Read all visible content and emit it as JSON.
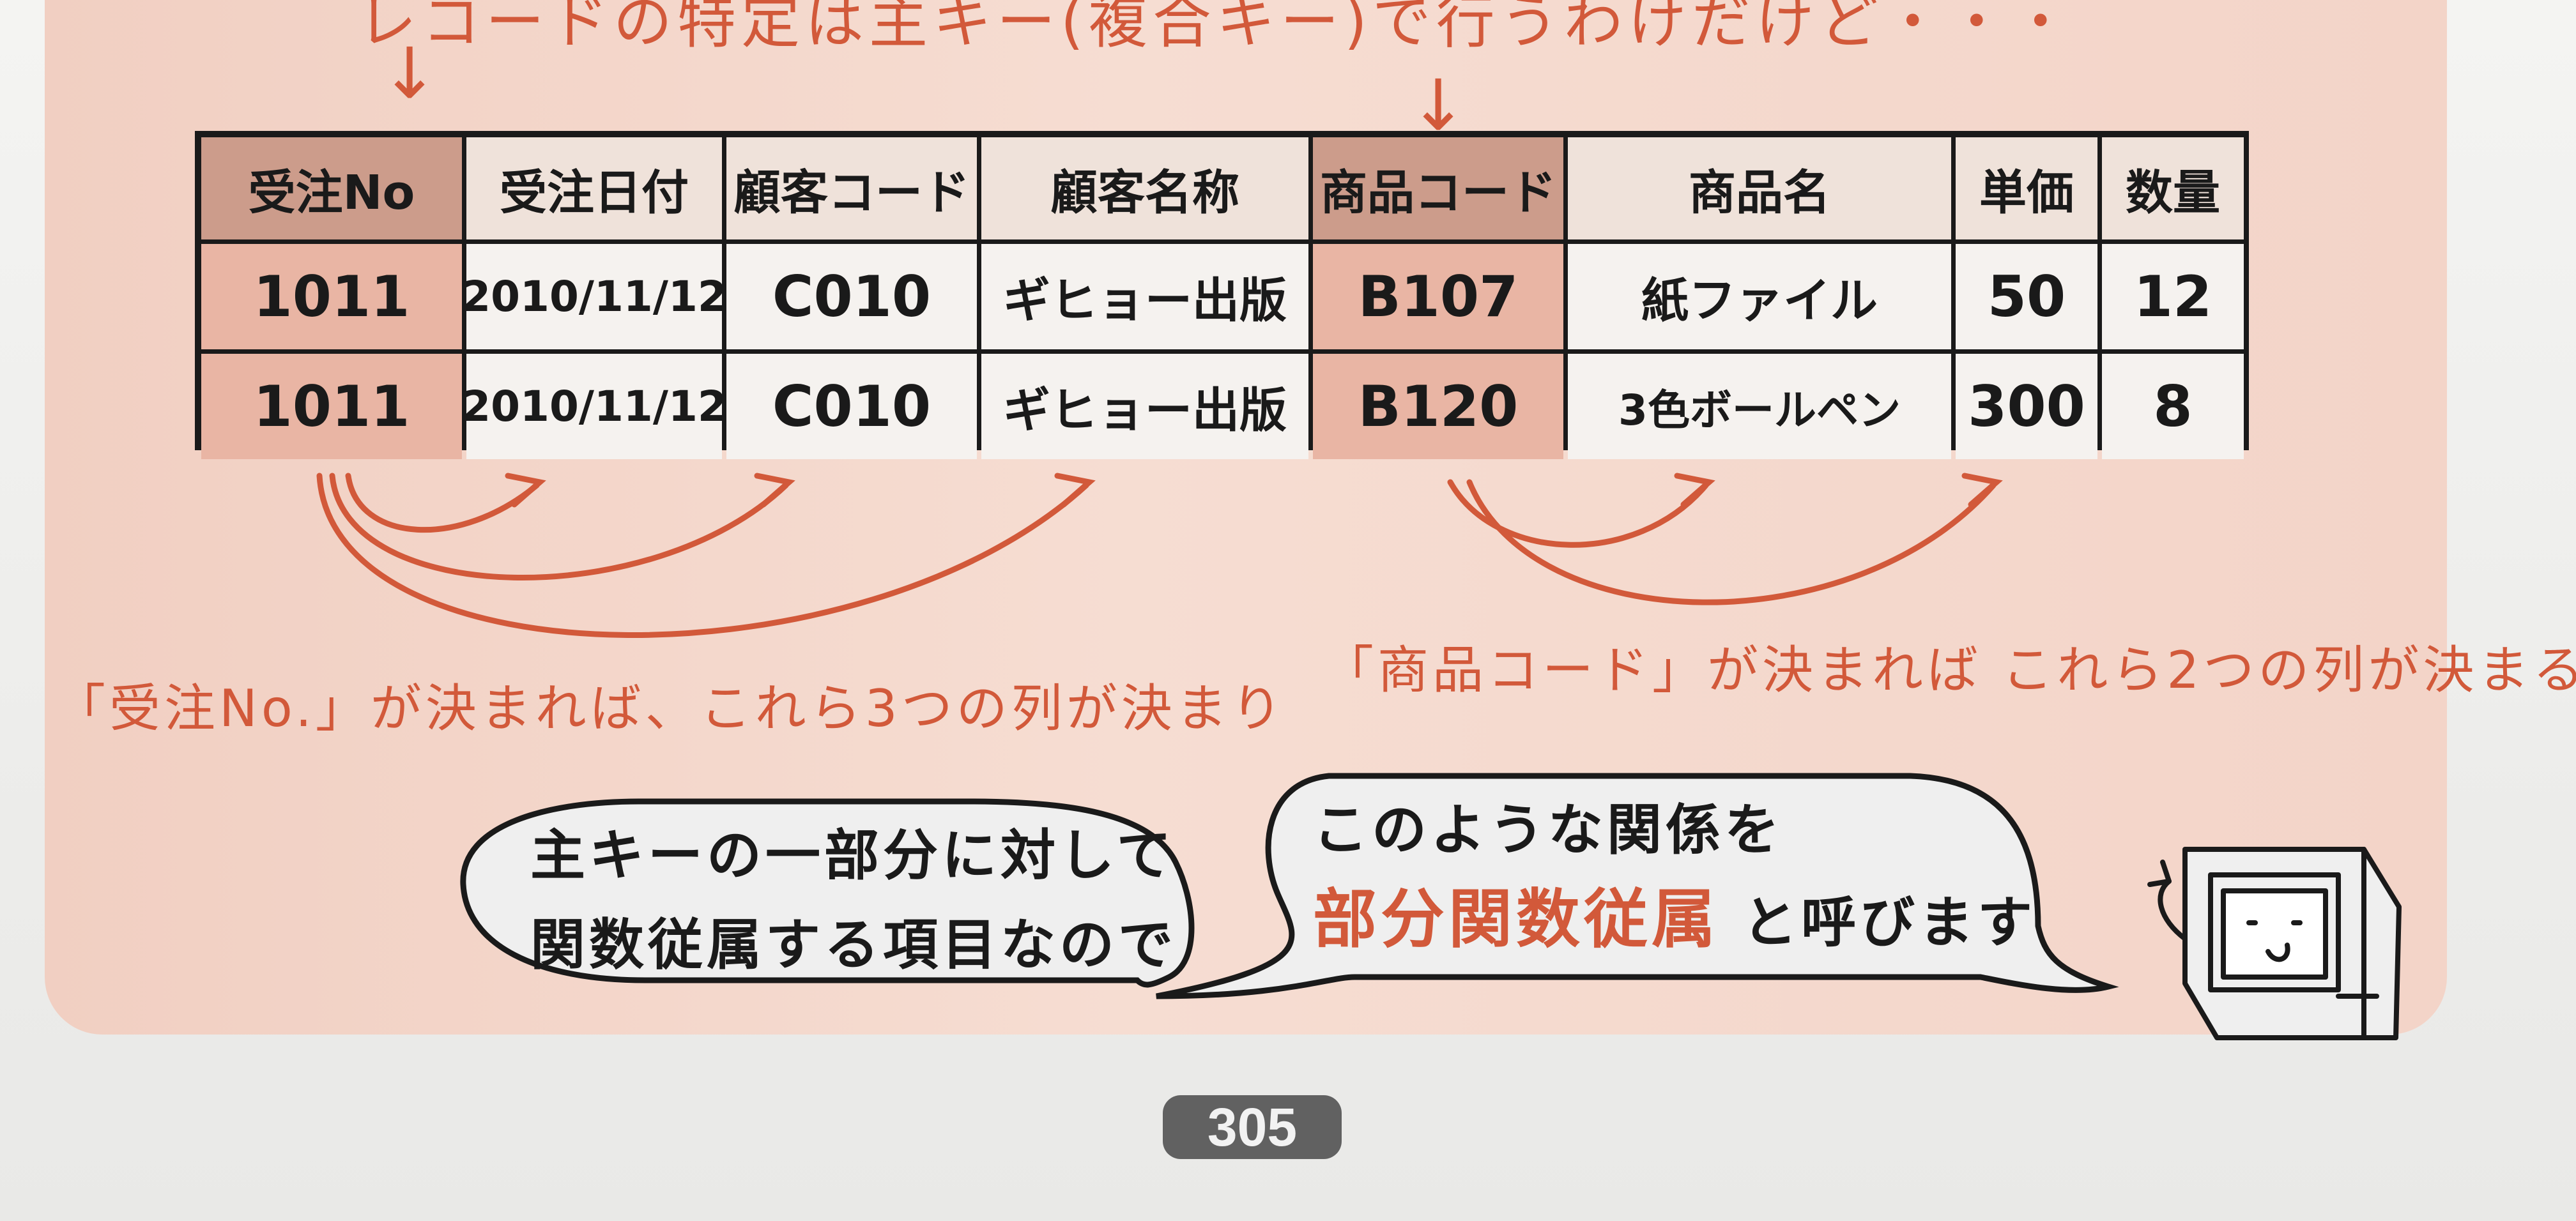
{
  "top_note": "レコードの特定は主キー(複合キー)で行うわけだけど・・・",
  "arrow_glyph": "↓",
  "table": {
    "headers": [
      "受注No",
      "受注日付",
      "顧客コード",
      "顧客名称",
      "商品コード",
      "商品名",
      "単価",
      "数量"
    ],
    "rows": [
      [
        "1011",
        "2010/11/12",
        "C010",
        "ギヒョー出版",
        "B107",
        "紙ファイル",
        "50",
        "12"
      ],
      [
        "1011",
        "2010/11/12",
        "C010",
        "ギヒョー出版",
        "B120",
        "3色ボールペン",
        "300",
        "8"
      ]
    ]
  },
  "labels": {
    "left": "「受注No.」が決まれば、これら3つの列が決まり",
    "right": "「商品コード」が決まれば これら2つの列が決まる"
  },
  "bubbles": {
    "left": {
      "line1": "主キーの一部分に対して",
      "line2": "関数従属する項目なので"
    },
    "right": {
      "line1": "このような関係を",
      "emphasis": "部分関数従属",
      "line2_rest": " と呼びます"
    }
  },
  "page_number": "305",
  "colors": {
    "accent": "#d2593a",
    "panel": "#f3d4c8",
    "key_header": "#cc9c8b",
    "key_cell": "#e9b5a4"
  }
}
